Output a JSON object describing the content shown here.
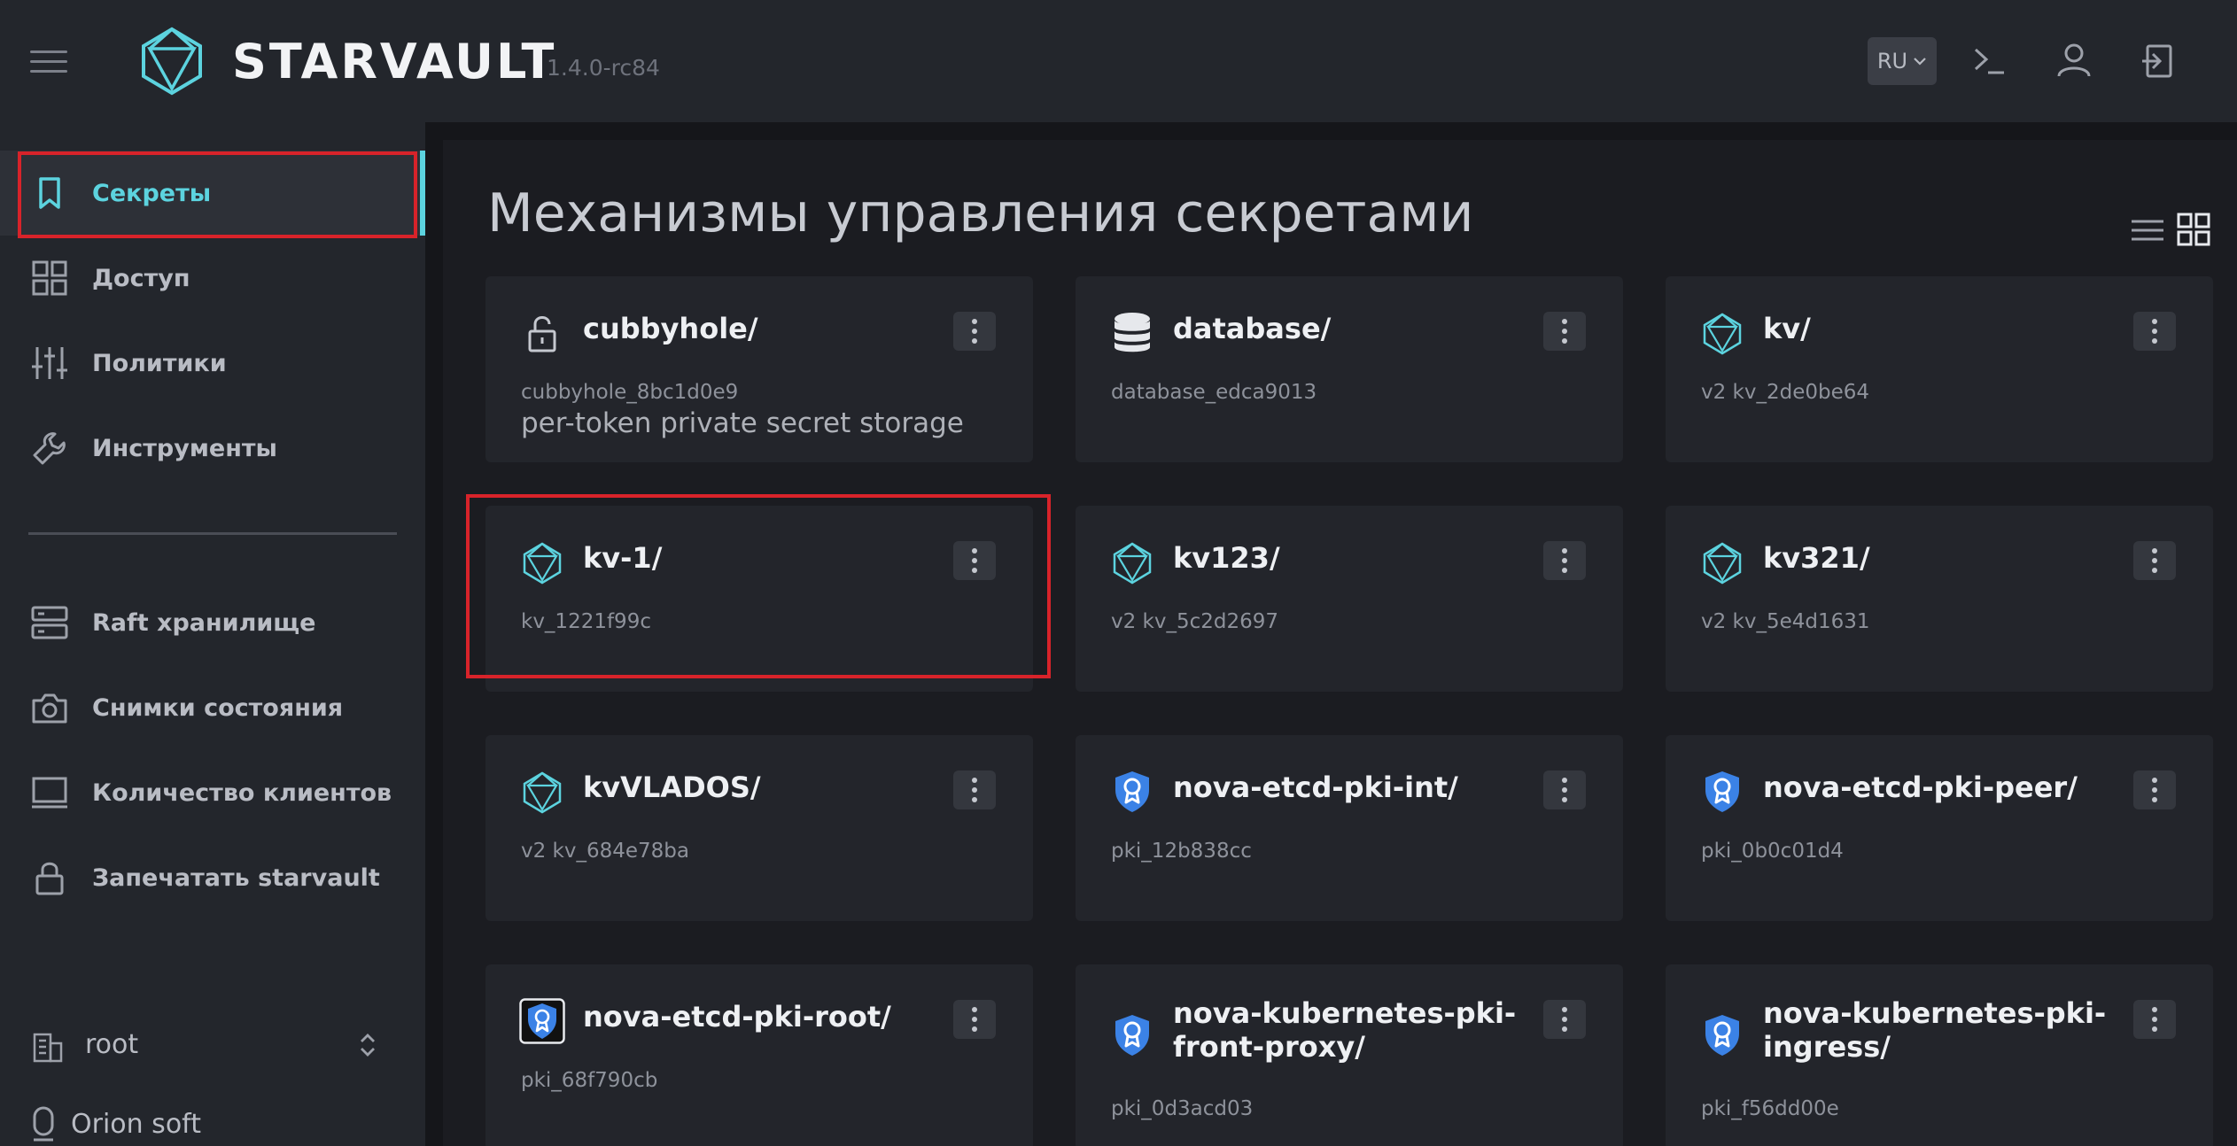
{
  "header": {
    "brand": "STARVAULT",
    "version": "1.4.0-rc84",
    "language": "RU",
    "icons": [
      "terminal-icon",
      "user-icon",
      "logout-icon"
    ]
  },
  "sidebar": {
    "items": [
      {
        "label": "Секреты",
        "icon": "bookmark-icon",
        "active": true
      },
      {
        "label": "Доступ",
        "icon": "grid-icon"
      },
      {
        "label": "Политики",
        "icon": "sliders-icon"
      },
      {
        "label": "Инструменты",
        "icon": "wrench-icon"
      },
      {
        "label": "Raft хранилище",
        "icon": "server-icon"
      },
      {
        "label": "Снимки состояния",
        "icon": "camera-icon"
      },
      {
        "label": "Количество клиентов",
        "icon": "monitor-icon"
      },
      {
        "label": "Запечатать starvault",
        "icon": "lock-icon"
      }
    ],
    "namespace": "root",
    "organization": "Orion soft"
  },
  "main": {
    "title": "Механизмы управления секретами",
    "cards": [
      {
        "name": "cubbyhole/",
        "id": "cubbyhole_8bc1d0e9",
        "description": "per-token private secret storage",
        "icon": "unlock-icon"
      },
      {
        "name": "database/",
        "id": "database_edca9013",
        "icon": "database-icon"
      },
      {
        "name": "kv/",
        "id": "v2 kv_2de0be64",
        "icon": "kv-icon"
      },
      {
        "name": "kv-1/",
        "id": "kv_1221f99c",
        "icon": "kv-icon"
      },
      {
        "name": "kv123/",
        "id": "v2 kv_5c2d2697",
        "icon": "kv-icon"
      },
      {
        "name": "kv321/",
        "id": "v2 kv_5e4d1631",
        "icon": "kv-icon"
      },
      {
        "name": "kvVLADOS/",
        "id": "v2 kv_684e78ba",
        "icon": "kv-icon"
      },
      {
        "name": "nova-etcd-pki-int/",
        "id": "pki_12b838cc",
        "icon": "pki-certificate-icon"
      },
      {
        "name": "nova-etcd-pki-peer/",
        "id": "pki_0b0c01d4",
        "icon": "pki-certificate-icon"
      },
      {
        "name": "nova-etcd-pki-root/",
        "id": "pki_68f790cb",
        "icon": "pki-certificate-icon"
      },
      {
        "name": "nova-kubernetes-pki-front-proxy/",
        "id": "pki_0d3acd03",
        "icon": "pki-certificate-icon"
      },
      {
        "name": "nova-kubernetes-pki-ingress/",
        "id": "pki_f56dd00e",
        "icon": "pki-certificate-icon"
      }
    ]
  },
  "colors": {
    "accent": "#5cd3df",
    "highlight": "#d8232a",
    "pki_blue": "#3b82e6"
  }
}
